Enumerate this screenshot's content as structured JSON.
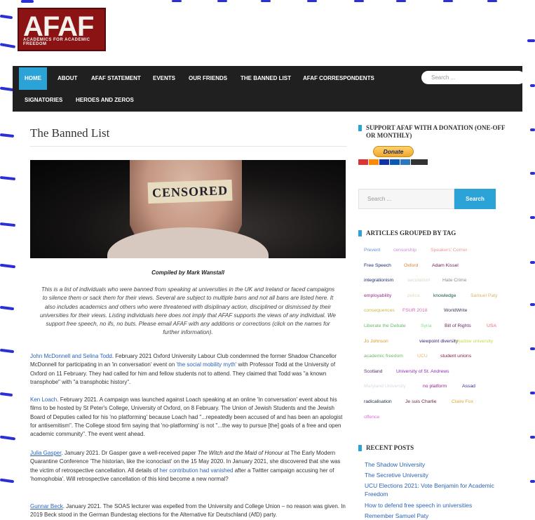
{
  "site": {
    "logo_text": "AFAF",
    "logo_tagline": "ACADEMICS FOR ACADEMIC FREEDOM"
  },
  "nav": {
    "items": [
      "HOME",
      "ABOUT",
      "AFAF STATEMENT",
      "EVENTS",
      "OUR FRIENDS",
      "THE BANNED LIST",
      "AFAF CORRESPONDENTS",
      "SIGNATORIES",
      "HEROES AND ZEROS"
    ],
    "search_placeholder": "Search ..."
  },
  "main": {
    "title": "The Banned List",
    "image_text": "CENSORED",
    "compiled_by": "Compiled by Mark Wanstall",
    "intro": "This is a list of individuals who were banned from speaking at universities in the UK and Ireland or faced campaigns to silence them or sack them for their views. Several are subject to multiple bans and not all bans are listed here. It also includes academics and others who were threatened with disiplinary action, disciplined or dismissed by their universities for their views. Listing individuals here does not imply that AFAF supports the views of any individual. We support free speech, no ifs, no buts. Please email AFAF with any additions or corrections (click on the names for further information).",
    "entries": [
      {
        "link": "John McDonnell and Selina Todd",
        "text_a": ". February 2021 Oxford University Labour Club condemned the former Shadow Chancellor McDonnell for participating in an 'in conversation' event on ",
        "inline_link": "'the social mobility myth'",
        "text_b": " with Professor Todd at the University of Oxford on 11 February. They had called for him and fellow students not to attend.  They claimed that Todd was \"a known transphobe\" with \"a transphobic history\"."
      },
      {
        "link": "Ken Loach",
        "text_a": ". February 2021. A campaign was launched against Loach speaking at an online 'In conversation' event about his films to be hosted by St Peter's College, University of Oxford, on 8 February. The Union of Jewish Students and the Jewish Board of Deputies called for his 'no platforming' because Loach had \"...repeatedly been accused of and has been an apologist for antisemitism\". The College stood firm saying that 'no-platforming' is not \"...the way to pursue [the] goals of a free and open academic community\". The event went ahead."
      },
      {
        "link": "Julia Gasper",
        "text_a": ". January 2021.  Dr Gasper gave a well-received paper ",
        "title_italic": "The Witch and the Maid of Honour",
        "text_b": " at The Early Modern Quarantine Conference 'The historian, like the iconoclast' on the 15 May 2020. In January 2021, she discovered that she was the victim of retrospective cancellation. All details of ",
        "inline_link": "her contribution had vanished",
        "text_c": " after a Twitter campaign accusing her of 'homophobia'. Will retrospective cancellation of this kind become a new normal?"
      },
      {
        "link": "Gunnar Beck",
        "text_a": ". January 2021. The SOAS lecturer was expelled from the University and College Union – no reason was given. In 2019 Beck stood in the German Bundestag elections for the Alternative für Deutschland (AfD) party."
      }
    ]
  },
  "sidebar": {
    "donate_title": "SUPPORT AFAF WITH A DONATION (ONE-OFF OR MONTHLY)",
    "donate_button": "Donate",
    "search_placeholder": "Search ...",
    "search_button": "Search",
    "tags_title": "ARTICLES GROUPED BY TAG",
    "tags": [
      {
        "label": "Prevent",
        "color": "#6a8bd8"
      },
      {
        "label": "censorship",
        "color": "#c58bd8"
      },
      {
        "label": "Speakers' Corner",
        "color": "#e89a9a"
      },
      {
        "label": "Free Speech",
        "color": "#1a2a6e"
      },
      {
        "label": "Oxford",
        "color": "#e0843c"
      },
      {
        "label": "Adam Kissel",
        "color": "#6a1a5a"
      },
      {
        "label": "integrationism",
        "color": "#1a2a6e"
      },
      {
        "label": "secularism",
        "color": "#d8d8c8"
      },
      {
        "label": "Hate Crime",
        "color": "#8a8a8a"
      },
      {
        "label": "employability",
        "color": "#9a2a8a"
      },
      {
        "label": "police",
        "color": "#e8d8b8"
      },
      {
        "label": "knowledge",
        "color": "#1a5a3a"
      },
      {
        "label": "Samuel Paty",
        "color": "#d8b86a"
      },
      {
        "label": "consequences",
        "color": "#c8b84a"
      },
      {
        "label": "FSUR 2018",
        "color": "#d86ab8"
      },
      {
        "label": "WorldWrite",
        "color": "#3a3a5a"
      },
      {
        "label": "Liberate the Debate",
        "color": "#6ab86a"
      },
      {
        "label": "Syria",
        "color": "#8ad88a"
      },
      {
        "label": "Bill of Rights",
        "color": "#6a2a5a"
      },
      {
        "label": "USA",
        "color": "#e86a6a"
      },
      {
        "label": "Jo Johnson",
        "color": "#d89a2a"
      },
      {
        "label": "viewpoint diversity",
        "color": "#3a1a6e"
      },
      {
        "label": "shadow university",
        "color": "#c8d84a"
      },
      {
        "label": "academic freedom",
        "color": "#6ab86a"
      },
      {
        "label": "UCU",
        "color": "#e8b86a"
      },
      {
        "label": "student unions",
        "color": "#8a1a3a"
      },
      {
        "label": "Scotland",
        "color": "#5a2a6e"
      },
      {
        "label": "University of St. Andrews",
        "color": "#8a2ab8"
      },
      {
        "label": "Maryland University",
        "color": "#d8d8e8"
      },
      {
        "label": "no platform",
        "color": "#9a1a8a"
      },
      {
        "label": "Assad",
        "color": "#3a2a8a"
      },
      {
        "label": "radicalisation",
        "color": "#1a2a4a"
      },
      {
        "label": "Je suis Charlie",
        "color": "#6a2a3a"
      },
      {
        "label": "Claire Fox",
        "color": "#d8a83a"
      },
      {
        "label": "offence",
        "color": "#d86ad8"
      }
    ],
    "recent_title": "RECENT POSTS",
    "recent_posts": [
      "The Shadow University",
      "The Secretive University",
      "UCU Elections 2021: Vote Benjamin for Academic Freedom",
      "How to defend free speech in universities",
      "Remember Samuel Paty"
    ]
  }
}
